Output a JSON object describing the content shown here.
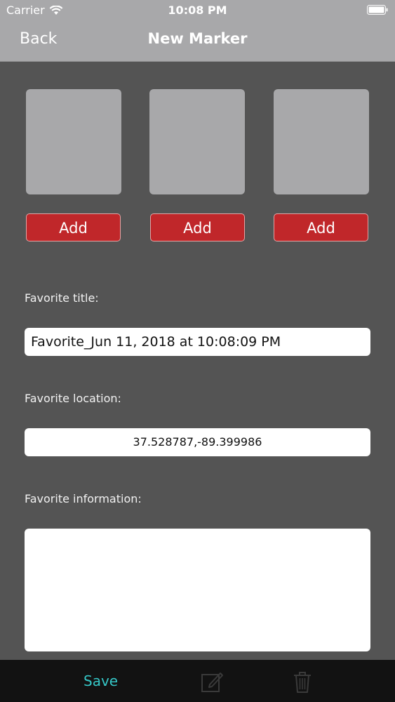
{
  "status_bar": {
    "carrier": "Carrier",
    "time": "10:08 PM",
    "wifi_icon": "wifi-icon",
    "battery_icon": "battery-icon"
  },
  "nav": {
    "back_label": "Back",
    "title": "New Marker"
  },
  "photos": {
    "add_labels": [
      "Add",
      "Add",
      "Add"
    ]
  },
  "form": {
    "title_label": "Favorite title:",
    "title_value": "Favorite_Jun 11, 2018 at 10:08:09 PM",
    "location_label": "Favorite location:",
    "location_value": "37.528787,-89.399986",
    "info_label": "Favorite information:",
    "info_value": ""
  },
  "toolbar": {
    "save_label": "Save",
    "edit_icon": "edit-icon",
    "trash_icon": "trash-icon"
  },
  "colors": {
    "background": "#545454",
    "nav_bar": "#a8a8aa",
    "add_button": "#c0272a",
    "save_text": "#35c6c6",
    "toolbar": "#121212"
  }
}
